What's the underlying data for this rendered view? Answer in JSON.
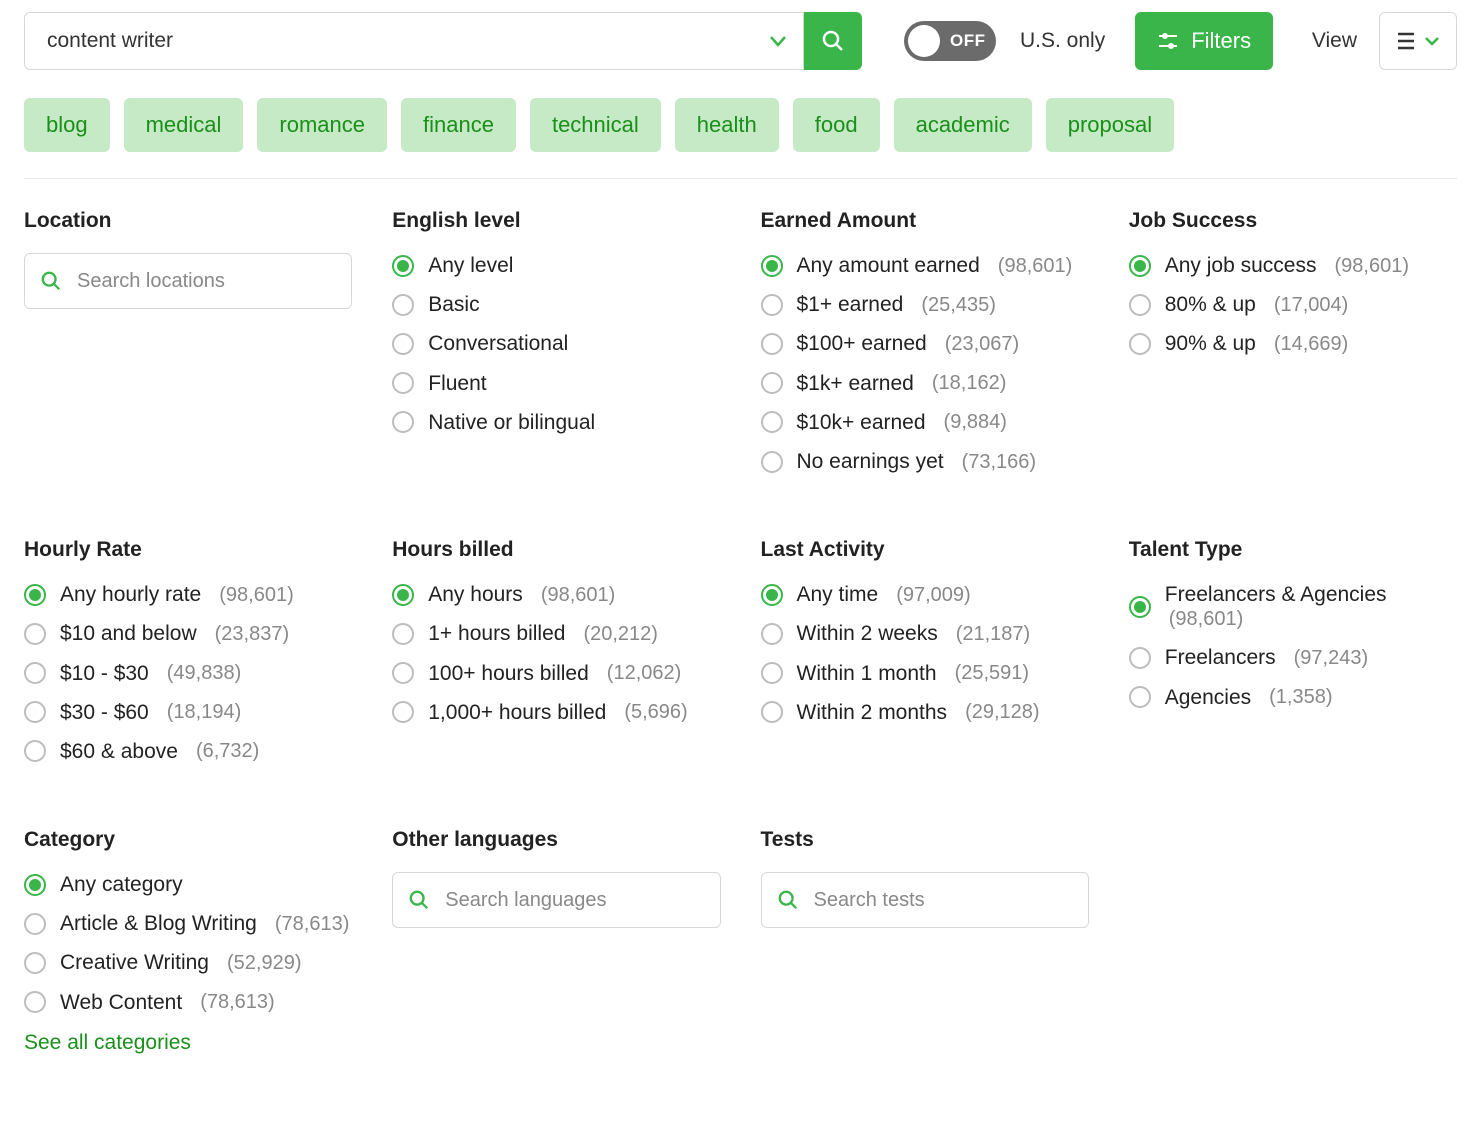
{
  "search": {
    "value": "content writer"
  },
  "toggle_label": "OFF",
  "us_only": "U.S. only",
  "filters_label": "Filters",
  "view_label": "View",
  "chips": [
    "blog",
    "medical",
    "romance",
    "finance",
    "technical",
    "health",
    "food",
    "academic",
    "proposal"
  ],
  "location": {
    "title": "Location",
    "placeholder": "Search locations"
  },
  "english": {
    "title": "English level",
    "options": [
      {
        "label": "Any level",
        "selected": true
      },
      {
        "label": "Basic"
      },
      {
        "label": "Conversational"
      },
      {
        "label": "Fluent"
      },
      {
        "label": "Native or bilingual"
      }
    ]
  },
  "earned": {
    "title": "Earned Amount",
    "options": [
      {
        "label": "Any amount earned",
        "count": "(98,601)",
        "selected": true
      },
      {
        "label": "$1+ earned",
        "count": "(25,435)"
      },
      {
        "label": "$100+ earned",
        "count": "(23,067)"
      },
      {
        "label": "$1k+ earned",
        "count": "(18,162)"
      },
      {
        "label": "$10k+ earned",
        "count": "(9,884)"
      },
      {
        "label": "No earnings yet",
        "count": "(73,166)"
      }
    ]
  },
  "jobsuccess": {
    "title": "Job Success",
    "options": [
      {
        "label": "Any job success",
        "count": "(98,601)",
        "selected": true
      },
      {
        "label": "80% & up",
        "count": "(17,004)"
      },
      {
        "label": "90% & up",
        "count": "(14,669)"
      }
    ]
  },
  "hourly": {
    "title": "Hourly Rate",
    "options": [
      {
        "label": "Any hourly rate",
        "count": "(98,601)",
        "selected": true
      },
      {
        "label": "$10 and below",
        "count": "(23,837)"
      },
      {
        "label": "$10 - $30",
        "count": "(49,838)"
      },
      {
        "label": "$30 - $60",
        "count": "(18,194)"
      },
      {
        "label": "$60 & above",
        "count": "(6,732)"
      }
    ]
  },
  "hoursbilled": {
    "title": "Hours billed",
    "options": [
      {
        "label": "Any hours",
        "count": "(98,601)",
        "selected": true
      },
      {
        "label": "1+ hours billed",
        "count": "(20,212)"
      },
      {
        "label": "100+ hours billed",
        "count": "(12,062)"
      },
      {
        "label": "1,000+ hours billed",
        "count": "(5,696)"
      }
    ]
  },
  "lastactivity": {
    "title": "Last Activity",
    "options": [
      {
        "label": "Any time",
        "count": "(97,009)",
        "selected": true
      },
      {
        "label": "Within 2 weeks",
        "count": "(21,187)"
      },
      {
        "label": "Within 1 month",
        "count": "(25,591)"
      },
      {
        "label": "Within 2 months",
        "count": "(29,128)"
      }
    ]
  },
  "talenttype": {
    "title": "Talent Type",
    "options": [
      {
        "label": "Freelancers & Agencies",
        "count": "(98,601)",
        "selected": true
      },
      {
        "label": "Freelancers",
        "count": "(97,243)"
      },
      {
        "label": "Agencies",
        "count": "(1,358)"
      }
    ]
  },
  "category": {
    "title": "Category",
    "see_all": "See all categories",
    "options": [
      {
        "label": "Any category",
        "selected": true
      },
      {
        "label": "Article & Blog Writing",
        "count": "(78,613)"
      },
      {
        "label": "Creative Writing",
        "count": "(52,929)"
      },
      {
        "label": "Web Content",
        "count": "(78,613)"
      }
    ]
  },
  "otherlang": {
    "title": "Other languages",
    "placeholder": "Search languages"
  },
  "tests": {
    "title": "Tests",
    "placeholder": "Search tests"
  }
}
